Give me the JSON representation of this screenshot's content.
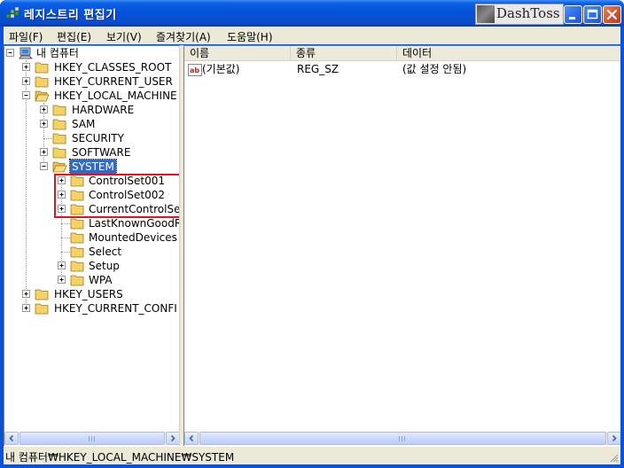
{
  "window": {
    "title": "레지스트리 편집기",
    "watermark": "DashToss"
  },
  "menu": [
    "파일(F)",
    "편집(E)",
    "보기(V)",
    "즐겨찾기(A)",
    "도움말(H)"
  ],
  "tree": {
    "root": "내 컴퓨터",
    "hkcr": "HKEY_CLASSES_ROOT",
    "hkcu": "HKEY_CURRENT_USER",
    "hklm": "HKEY_LOCAL_MACHINE",
    "hardware": "HARDWARE",
    "sam": "SAM",
    "security": "SECURITY",
    "software": "SOFTWARE",
    "system": "SYSTEM",
    "cs001": "ControlSet001",
    "cs002": "ControlSet002",
    "ccs": "CurrentControlSet",
    "lkg": "LastKnownGoodR",
    "mounted": "MountedDevices",
    "select": "Select",
    "setup": "Setup",
    "wpa": "WPA",
    "hku": "HKEY_USERS",
    "hkcc": "HKEY_CURRENT_CONFI"
  },
  "list": {
    "col_name": "이름",
    "col_type": "종류",
    "col_data": "데이터",
    "row_name": "(기본값)",
    "row_type": "REG_SZ",
    "row_data": "(값 설정 안됨)"
  },
  "status": "내 컴퓨터₩HKEY_LOCAL_MACHINE₩SYSTEM",
  "colors": {
    "titlebar": "#0552d8",
    "selection": "#316ac5",
    "highlight_box": "#e0141e",
    "folder": "#f4d266"
  }
}
